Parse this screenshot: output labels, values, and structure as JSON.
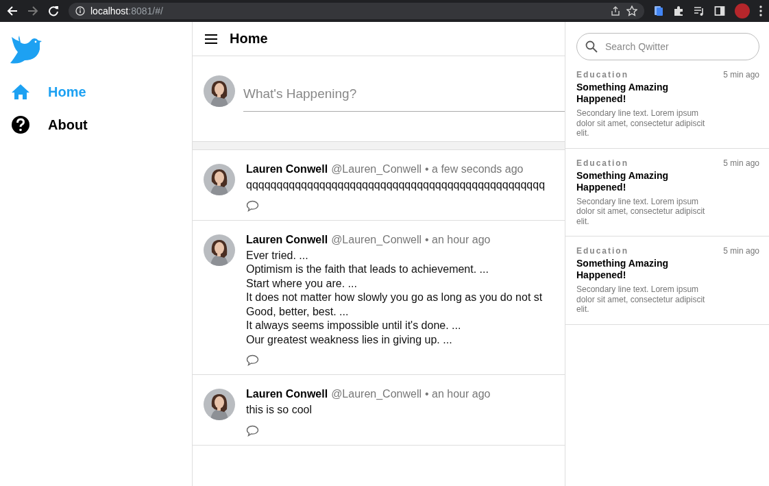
{
  "browser": {
    "forward_disabled": true,
    "url_host": "localhost",
    "url_rest": ":8081/#/"
  },
  "sidebar": {
    "items": [
      {
        "label": "Home",
        "kind": "home",
        "selected": true
      },
      {
        "label": "About",
        "kind": "help",
        "selected": false
      }
    ]
  },
  "header": {
    "title": "Home"
  },
  "compose": {
    "placeholder": "What's Happening?"
  },
  "tweets": [
    {
      "name": "Lauren Conwell",
      "handle": "@Lauren_Conwell",
      "time": "• a few seconds ago",
      "lines": [
        "qqqqqqqqqqqqqqqqqqqqqqqqqqqqqqqqqqqqqqqqqqqqqqqqq"
      ]
    },
    {
      "name": "Lauren Conwell",
      "handle": "@Lauren_Conwell",
      "time": "• an hour ago",
      "lines": [
        "Ever tried. ...",
        "Optimism is the faith that leads to achievement. ...",
        "Start where you are. ...",
        "It does not matter how slowly you go as long as you do not st",
        "Good, better, best. ...",
        "It always seems impossible until it's done. ...",
        "Our greatest weakness lies in giving up. ..."
      ]
    },
    {
      "name": "Lauren Conwell",
      "handle": "@Lauren_Conwell",
      "time": "• an hour ago",
      "lines": [
        "this is so cool"
      ]
    }
  ],
  "search": {
    "placeholder": "Search Qwitter"
  },
  "trends": [
    {
      "category": "Education",
      "time": "5 min ago",
      "title": "Something Amazing Happened!",
      "text": "Secondary line text. Lorem ipsum dolor sit amet, consectetur adipiscit elit."
    },
    {
      "category": "Education",
      "time": "5 min ago",
      "title": "Something Amazing Happened!",
      "text": "Secondary line text. Lorem ipsum dolor sit amet, consectetur adipiscit elit."
    },
    {
      "category": "Education",
      "time": "5 min ago",
      "title": "Something Amazing Happened!",
      "text": "Secondary line text. Lorem ipsum dolor sit amet, consectetur adipiscit elit."
    }
  ]
}
